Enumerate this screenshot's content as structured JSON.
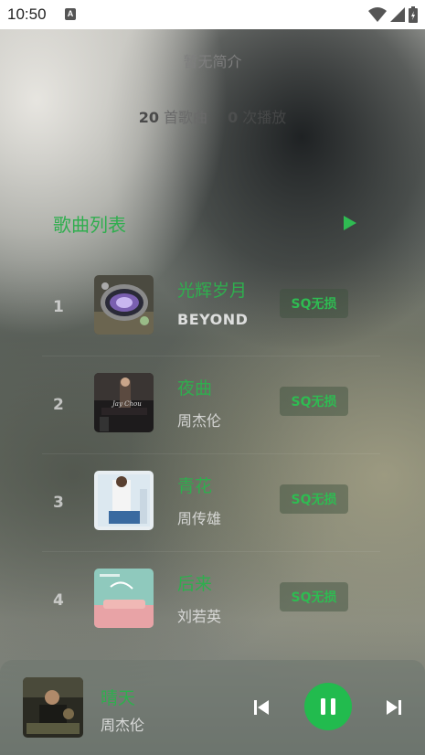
{
  "status_bar": {
    "time": "10:50",
    "notification_icon": "a-icon"
  },
  "playlist": {
    "description": "暂无简介",
    "song_count": "20",
    "song_count_unit": "首歌曲",
    "play_count": "0",
    "play_count_unit": "次播放"
  },
  "song_list": {
    "title": "歌曲列表",
    "accent": "#2fae4e",
    "songs": [
      {
        "index": "1",
        "title": "光辉岁月",
        "artist": "BEYOND",
        "quality": "SQ无损"
      },
      {
        "index": "2",
        "title": "夜曲",
        "artist": "周杰伦",
        "quality": "SQ无损"
      },
      {
        "index": "3",
        "title": "青花",
        "artist": "周传雄",
        "quality": "SQ无损"
      },
      {
        "index": "4",
        "title": "后来",
        "artist": "刘若英",
        "quality": "SQ无损"
      }
    ]
  },
  "player": {
    "title": "晴天",
    "artist": "周杰伦",
    "state": "playing",
    "button_color": "#22bb4e"
  }
}
